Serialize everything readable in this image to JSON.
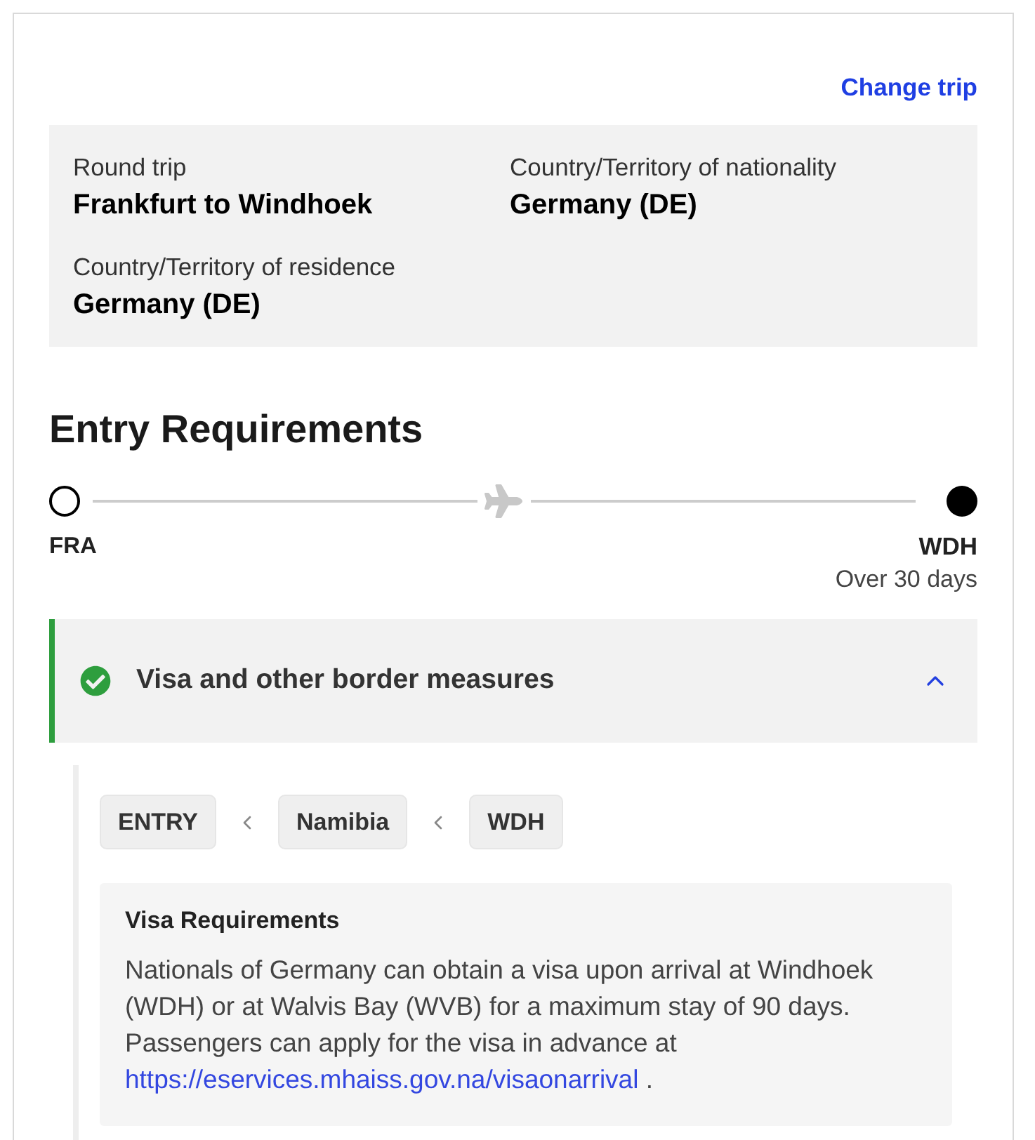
{
  "header": {
    "change_trip_link": "Change trip"
  },
  "trip_summary": {
    "fields": [
      {
        "label": "Round trip",
        "value": "Frankfurt to Windhoek"
      },
      {
        "label": "Country/Territory of nationality",
        "value": "Germany (DE)"
      },
      {
        "label": "Country/Territory of residence",
        "value": "Germany (DE)"
      }
    ]
  },
  "entry_requirements": {
    "title": "Entry Requirements",
    "route": {
      "origin": {
        "code": "FRA"
      },
      "destination": {
        "code": "WDH",
        "duration": "Over 30 days"
      }
    }
  },
  "sections": [
    {
      "title": "Visa and other border measures",
      "cleared": true,
      "expanded": true,
      "breadcrumb": [
        "ENTRY",
        "Namibia",
        "WDH"
      ],
      "details": {
        "title": "Visa Requirements",
        "text": "Nationals of Germany can obtain a visa upon arrival at Windhoek (WDH) or at Walvis Bay (WVB) for a maximum stay of 90 days. Passengers can apply for the visa in advance at ",
        "link": "https://eservices.mhaiss.gov.na/visaonarrival",
        "text_after": " ."
      }
    }
  ]
}
